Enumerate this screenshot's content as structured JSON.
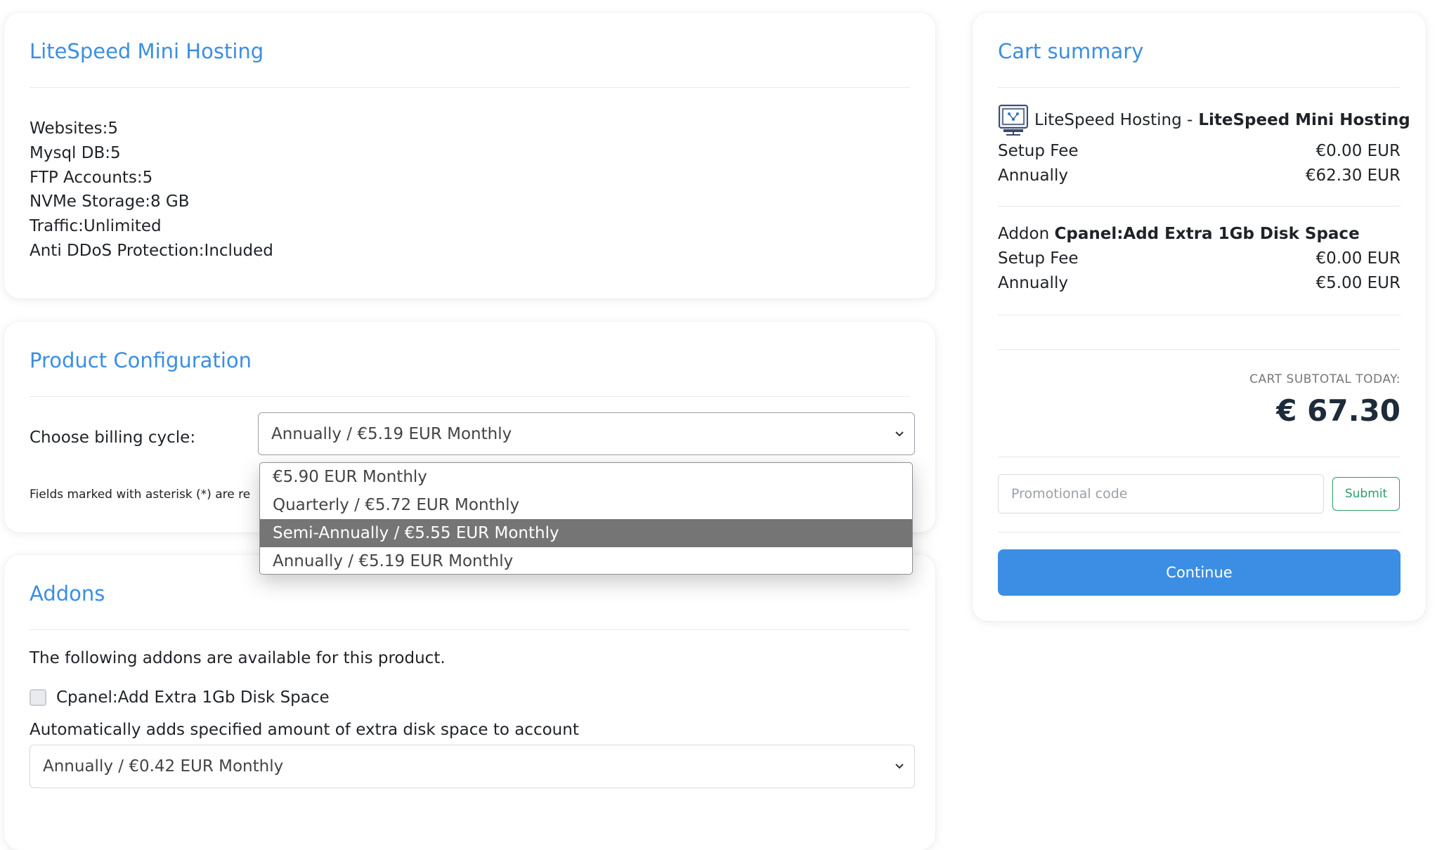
{
  "product": {
    "title": "LiteSpeed Mini Hosting",
    "features": [
      {
        "label": "Websites:",
        "value": "5"
      },
      {
        "label": "Mysql DB:",
        "value": "5"
      },
      {
        "label": "FTP Accounts:",
        "value": "5"
      },
      {
        "label": "NVMe Storage:",
        "value": "8 GB"
      },
      {
        "label": "Traffic:",
        "value": "Unlimited"
      },
      {
        "label": "Anti DDoS Protection:",
        "value": "Included"
      }
    ]
  },
  "configuration": {
    "title": "Product Configuration",
    "billing_label": "Choose billing cycle:",
    "billing_selected": "Annually / €5.19 EUR Monthly",
    "required_note": "Fields marked with asterisk (*) are re",
    "billing_options": [
      "€5.90 EUR Monthly",
      "Quarterly / €5.72 EUR Monthly",
      "Semi-Annually / €5.55 EUR Monthly",
      "Annually / €5.19 EUR Monthly"
    ],
    "highlighted_option": "Semi-Annually / €5.55 EUR Monthly"
  },
  "addons": {
    "title": "Addons",
    "intro": "The following addons are available for this product.",
    "addon_name": "Cpanel:Add Extra 1Gb Disk Space",
    "addon_checked": false,
    "addon_description": "Automatically adds specified amount of extra disk space to account",
    "addon_billing_selected": "Annually / €0.42 EUR Monthly"
  },
  "cart": {
    "title": "Cart summary",
    "item": {
      "group": "LiteSpeed Hosting - ",
      "name": "LiteSpeed Mini Hosting",
      "icon": "server-icon",
      "setup_label": "Setup Fee",
      "setup_value": "€0.00 EUR",
      "cycle_label": "Annually",
      "cycle_value": "€62.30 EUR"
    },
    "addon": {
      "prefix": "Addon ",
      "name": "Cpanel:Add Extra 1Gb Disk Space",
      "setup_label": "Setup Fee",
      "setup_value": "€0.00 EUR",
      "cycle_label": "Annually",
      "cycle_value": "€5.00 EUR"
    },
    "subtotal_label": "CART SUBTOTAL TODAY:",
    "subtotal_value": "€ 67.30",
    "promo_placeholder": "Promotional code",
    "submit_label": "Submit",
    "continue_label": "Continue"
  },
  "colors": {
    "accent": "#3b8ee3",
    "submit_green": "#28a06a",
    "dropdown_highlight": "#757575"
  }
}
